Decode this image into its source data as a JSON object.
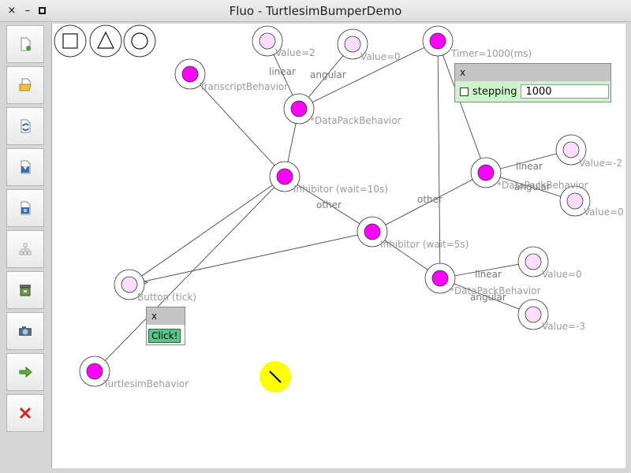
{
  "window": {
    "title": "Fluo - TurtlesimBumperDemo",
    "close_glyph": "×",
    "minimize_glyph": "–",
    "maximize_glyph": "□"
  },
  "toolbar": {
    "items": [
      {
        "name": "new-document-icon"
      },
      {
        "name": "open-folder-icon"
      },
      {
        "name": "reload-icon"
      },
      {
        "name": "save-icon"
      },
      {
        "name": "save-as-icon"
      },
      {
        "name": "hierarchy-icon"
      },
      {
        "name": "archive-icon"
      },
      {
        "name": "camera-icon"
      },
      {
        "name": "run-arrow-icon"
      },
      {
        "name": "delete-x-icon"
      }
    ]
  },
  "palette": [
    {
      "shape": "square",
      "name": "square-shape-icon"
    },
    {
      "shape": "triangle",
      "name": "triangle-shape-icon"
    },
    {
      "shape": "circle",
      "name": "circle-shape-icon"
    }
  ],
  "graph": {
    "nodes": [
      {
        "id": "transcript",
        "label": "TranscriptBehavior",
        "active": true
      },
      {
        "id": "value2",
        "label": "Value=2",
        "active": false
      },
      {
        "id": "value0_top",
        "label": "Value=0",
        "active": false
      },
      {
        "id": "timer",
        "label": "Timer=1000(ms)",
        "active": true
      },
      {
        "id": "datapack1",
        "label": "*DataPackBehavior",
        "active": true
      },
      {
        "id": "inhibitor10",
        "label": "Inhibitor (wait=10s)",
        "active": true
      },
      {
        "id": "inhibitor5",
        "label": "Inhibitor (wait=5s)",
        "active": true
      },
      {
        "id": "datapack2",
        "label": "*DataPackBehavior",
        "active": true
      },
      {
        "id": "valuem2",
        "label": "Value=-2",
        "active": false
      },
      {
        "id": "value0_r",
        "label": "Value=0",
        "active": false
      },
      {
        "id": "datapack3",
        "label": "*DataPackBehavior",
        "active": true
      },
      {
        "id": "value0_b",
        "label": "Value=0",
        "active": false
      },
      {
        "id": "valuem3",
        "label": "Value=-3",
        "active": false
      },
      {
        "id": "button",
        "label": "Button (tick)",
        "active": false
      },
      {
        "id": "turtlesim",
        "label": "TurtlesimBehavior",
        "active": true
      }
    ],
    "edge_labels": {
      "linear_1": "linear",
      "angular_1": "angular",
      "other_1": "other",
      "other_2": "other",
      "linear_2": "linear",
      "angular_2": "angular",
      "linear_3": "linear",
      "angular_3": "angular"
    }
  },
  "timer_panel": {
    "close": "x",
    "checkbox_label": "stepping",
    "checked": false,
    "value": "1000"
  },
  "button_panel": {
    "close": "x",
    "button_label": "Click!"
  },
  "turtle": {
    "color": "#ffff00",
    "name": "turtle-icon"
  },
  "colors": {
    "active_node": "#ff00ff",
    "inactive_node": "#ffddff",
    "node_border": "#333333",
    "panel_green": "#ccf5cc",
    "click_button": "#5cc48a"
  }
}
